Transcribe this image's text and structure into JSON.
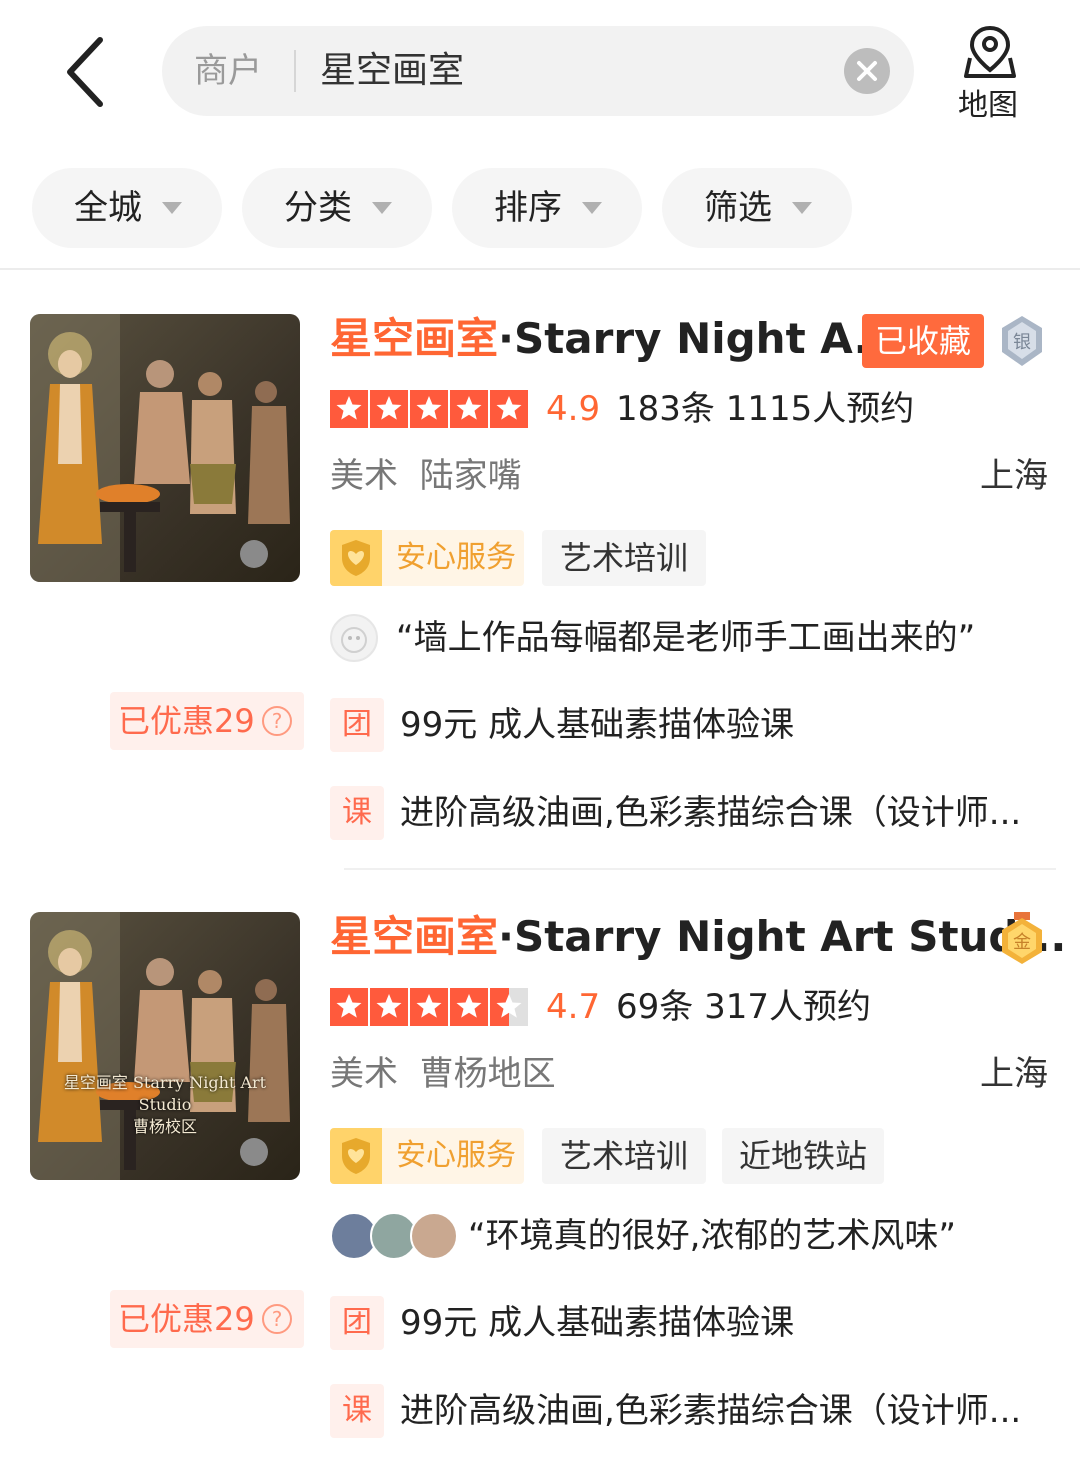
{
  "header": {
    "search_type": "商户",
    "search_value": "星空画室",
    "map_label": "地图"
  },
  "filters": [
    {
      "label": "全城"
    },
    {
      "label": "分类"
    },
    {
      "label": "排序"
    },
    {
      "label": "筛选"
    }
  ],
  "listings": [
    {
      "title_highlight": "星空画室",
      "title_rest": "·Starry Night A...",
      "favorite_label": "已收藏",
      "medal": "银",
      "score": "4.9",
      "stars": 5,
      "reviews": "183条  1115人预约",
      "category": "美术",
      "area": "陆家嘴",
      "city": "上海",
      "safe_tag": "安心服务",
      "tags": [
        "艺术培训"
      ],
      "review_quote": "“墙上作品每幅都是老师手工画出来的”",
      "saved": "已优惠29",
      "deals": [
        {
          "icon": "团",
          "text": "99元 成人基础素描体验课"
        },
        {
          "icon": "课",
          "text": "进阶高级油画,色彩素描综合课（设计师..."
        }
      ]
    },
    {
      "title_highlight": "星空画室",
      "title_rest": "·Starry Night Art Stud...",
      "medal": "金",
      "score": "4.7",
      "stars": 4.5,
      "reviews": "69条  317人预约",
      "category": "美术",
      "area": "曹杨地区",
      "city": "上海",
      "safe_tag": "安心服务",
      "tags": [
        "艺术培训",
        "近地铁站"
      ],
      "review_quote": "“环境真的很好,浓郁的艺术风味”",
      "saved": "已优惠29",
      "thumb_caption": [
        "星空画室 Starry Night Art",
        "Studio",
        "曹杨校区"
      ],
      "deals": [
        {
          "icon": "团",
          "text": "99元 成人基础素描体验课"
        },
        {
          "icon": "课",
          "text": "进阶高级油画,色彩素描综合课（设计师..."
        }
      ]
    }
  ],
  "colors": {
    "accent": "#ff6633",
    "favorite_bg": "#ff6a3d",
    "star": "#ff5a3c",
    "safe_gold": "#ffd36a"
  }
}
